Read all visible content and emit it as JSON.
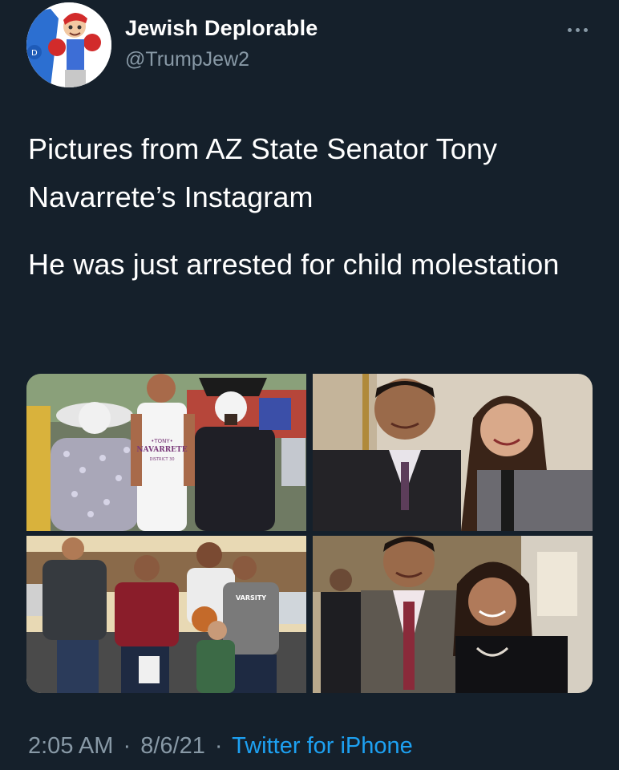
{
  "author": {
    "display_name": "Jewish Deplorable",
    "handle": "@TrumpJew2",
    "avatar_icon": "cartoon-boxer-avatar"
  },
  "more_icon": "ellipsis-icon",
  "tweet": {
    "paragraphs": [
      "Pictures from AZ State Senator Tony Navarrete’s Instagram",
      "He was just arrested for child molestation"
    ]
  },
  "media": {
    "photos": [
      {
        "description_icon": "photo-group-costumes",
        "shirt_text_top": "•TONY•",
        "shirt_text_main": "NAVARRETE",
        "shirt_text_sub": "DISTRICT 30"
      },
      {
        "description_icon": "photo-couple-portrait"
      },
      {
        "description_icon": "photo-group-youth",
        "shirt_text": "VARSITY"
      },
      {
        "description_icon": "photo-couple-portrait-2"
      }
    ]
  },
  "footer": {
    "time": "2:05 AM",
    "separator": "·",
    "date": "8/6/21",
    "source": "Twitter for iPhone"
  },
  "colors": {
    "background": "#15202b",
    "secondary_text": "#8899a6",
    "link": "#1da1f2"
  }
}
